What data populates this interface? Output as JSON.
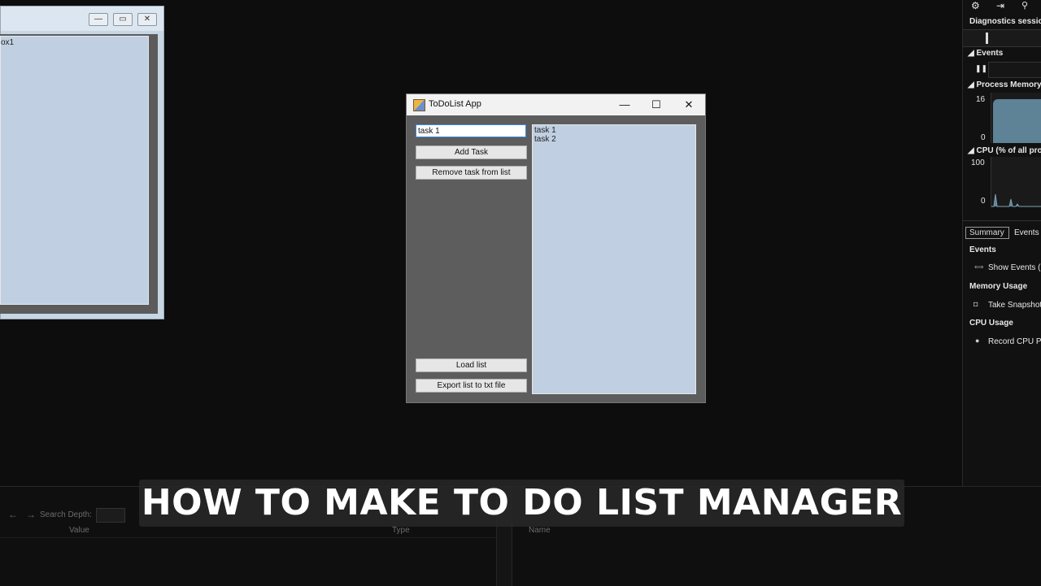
{
  "designer": {
    "listbox_label": "ox1",
    "controls": [
      "—",
      "▭",
      "✕"
    ]
  },
  "app": {
    "title": "ToDoList App",
    "controls": {
      "minimize": "—",
      "maximize": "☐",
      "close": "✕"
    },
    "task_input": {
      "value": "task 1"
    },
    "buttons": {
      "add_task": "Add Task",
      "remove_task": "Remove task from list",
      "load_list": "Load list",
      "export_list": "Export list to txt file"
    },
    "tasks": [
      "task 1",
      "task 2"
    ]
  },
  "diagnostics": {
    "session_label": "Diagnostics session",
    "events_header": "Events",
    "process_memory_header": "Process Memory",
    "memory_max": "16",
    "memory_min": "0",
    "cpu_header": "CPU (% of all proc",
    "cpu_max": "100",
    "cpu_min": "0",
    "tabs": {
      "summary": "Summary",
      "events": "Events"
    },
    "sections": {
      "events": "Events",
      "show_events": "Show Events (",
      "memory_usage": "Memory Usage",
      "take_snapshot": "Take Snapshot",
      "cpu_usage": "CPU Usage",
      "record_cpu": "Record CPU Pr"
    }
  },
  "bottom_panel": {
    "search_depth_label": "Search Depth:",
    "columns": {
      "value": "Value",
      "type": "Type",
      "name": "Name"
    }
  },
  "caption": {
    "text": "HOW TO MAKE TO DO LIST MANAGER"
  }
}
